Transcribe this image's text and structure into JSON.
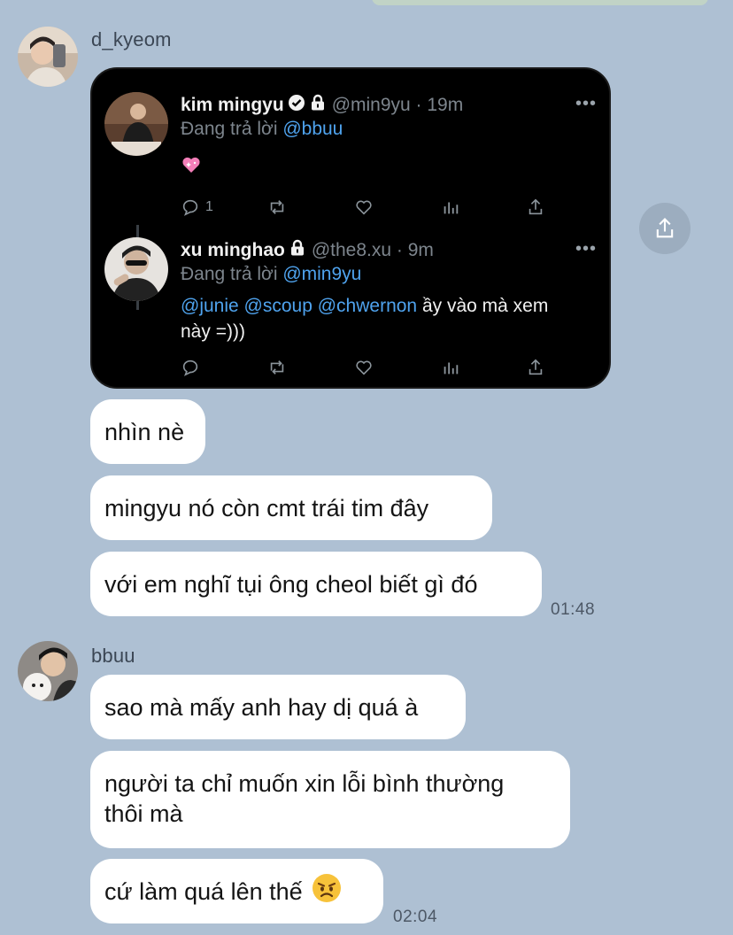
{
  "chat": {
    "messages_group_1": {
      "sender": "d_kyeom",
      "bubbles": [
        "nhìn nè",
        "mingyu nó còn cmt trái tim đây",
        "với em nghĩ tụi ông cheol biết gì đó"
      ],
      "time": "01:48"
    },
    "messages_group_2": {
      "sender": "bbuu",
      "bubbles": [
        "sao mà mấy anh hay dị quá à",
        "người ta chỉ muốn xin lỗi bình thường",
        "thôi mà",
        "cứ làm quá lên thế"
      ],
      "time": "02:04"
    }
  },
  "tweet": {
    "first": {
      "name": "kim mingyu",
      "handle": "@min9yu · 19m",
      "reply_prefix": "Đang trả lời",
      "reply_to": "@bbuu",
      "reply_count": "1",
      "more": "•••"
    },
    "second": {
      "name": "xu minghao",
      "handle": "@the8.xu · 9m",
      "reply_prefix": "Đang trả lời",
      "reply_to": "@min9yu",
      "mentions": [
        "@junie",
        "@scoup",
        "@chwernon"
      ],
      "text_1": "ầy vào mà xem",
      "text_2": "này =)))",
      "more": "•••"
    }
  },
  "icons": {
    "tweet_1_emoji": "sparkling-heart-icon",
    "angry_emoji": "angry-face-icon",
    "share": "share-icon"
  },
  "colors": {
    "background": "#aec0d3",
    "bubble": "#ffffff",
    "mention": "#4fa3ee",
    "tweet_bg": "#000000"
  }
}
